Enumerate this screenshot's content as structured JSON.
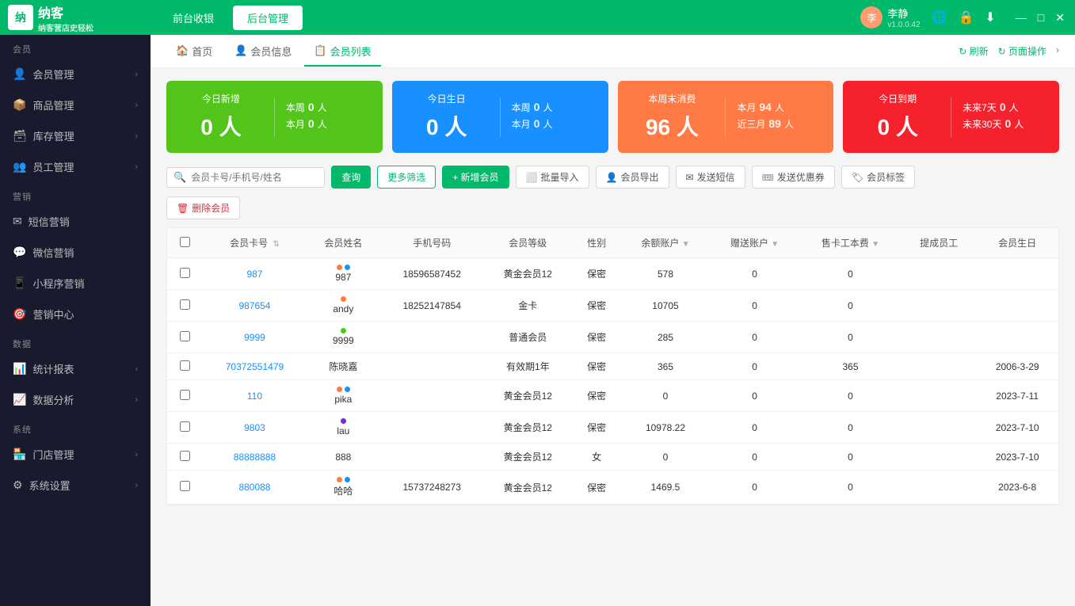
{
  "app": {
    "logo_text": "纳客",
    "logo_sub": "纳客营店史轻松",
    "tab_front": "前台收银",
    "tab_back": "后台管理",
    "version": "v1.0.0.42"
  },
  "user": {
    "name": "李静",
    "avatar_initial": "李"
  },
  "window_controls": {
    "minimize": "—",
    "maximize": "□",
    "close": "✕"
  },
  "sidebar": {
    "sections": [
      {
        "label": "会员",
        "items": [
          {
            "id": "member-mgmt",
            "icon": "👤",
            "label": "会员管理",
            "has_arrow": true
          },
          {
            "id": "product-mgmt",
            "icon": "📦",
            "label": "商品管理",
            "has_arrow": true
          },
          {
            "id": "inventory-mgmt",
            "icon": "🗃",
            "label": "库存管理",
            "has_arrow": true
          },
          {
            "id": "staff-mgmt",
            "icon": "👥",
            "label": "员工管理",
            "has_arrow": true
          }
        ]
      },
      {
        "label": "营销",
        "items": [
          {
            "id": "sms-marketing",
            "icon": "✉",
            "label": "短信营销",
            "has_arrow": false
          },
          {
            "id": "wechat-marketing",
            "icon": "💬",
            "label": "微信营销",
            "has_arrow": false
          },
          {
            "id": "mini-marketing",
            "icon": "📱",
            "label": "小程序营销",
            "has_arrow": false
          },
          {
            "id": "marketing-center",
            "icon": "🎯",
            "label": "营销中心",
            "has_arrow": false
          }
        ]
      },
      {
        "label": "数据",
        "items": [
          {
            "id": "stats-report",
            "icon": "📊",
            "label": "统计报表",
            "has_arrow": true
          },
          {
            "id": "data-analysis",
            "icon": "📈",
            "label": "数据分析",
            "has_arrow": true
          }
        ]
      },
      {
        "label": "系统",
        "items": [
          {
            "id": "store-mgmt",
            "icon": "🏪",
            "label": "门店管理",
            "has_arrow": true
          },
          {
            "id": "system-settings",
            "icon": "⚙",
            "label": "系统设置",
            "has_arrow": true
          }
        ]
      }
    ]
  },
  "nav": {
    "items": [
      {
        "id": "home",
        "icon": "🏠",
        "label": "首页",
        "active": false
      },
      {
        "id": "member-info",
        "icon": "👤",
        "label": "会员信息",
        "active": false
      },
      {
        "id": "member-list",
        "icon": "📋",
        "label": "会员列表",
        "active": true
      }
    ],
    "refresh": "刷新",
    "page_ops": "页面操作"
  },
  "stats": [
    {
      "id": "new-today",
      "color": "green",
      "title": "今日新增",
      "main_num": "0 人",
      "right": [
        {
          "label": "本周",
          "val": "0",
          "unit": "人"
        },
        {
          "label": "本月",
          "val": "0",
          "unit": "人"
        }
      ]
    },
    {
      "id": "birthday-today",
      "color": "blue",
      "title": "今日生日",
      "main_num": "0 人",
      "right": [
        {
          "label": "本周",
          "val": "0",
          "unit": "人"
        },
        {
          "label": "本月",
          "val": "0",
          "unit": "人"
        }
      ]
    },
    {
      "id": "no-consume",
      "color": "orange",
      "title": "本周末消费",
      "main_num": "96 人",
      "right": [
        {
          "label": "本月",
          "val": "94",
          "unit": "人"
        },
        {
          "label": "近三月",
          "val": "89",
          "unit": "人"
        }
      ]
    },
    {
      "id": "expiring",
      "color": "red",
      "title": "今日到期",
      "main_num": "0 人",
      "right": [
        {
          "label": "未来7天",
          "val": "0",
          "unit": "人"
        },
        {
          "label": "未来30天",
          "val": "0",
          "unit": "人"
        }
      ]
    }
  ],
  "toolbar": {
    "search_placeholder": "会员卡号/手机号/姓名",
    "search_btn": "查询",
    "filter_btn": "更多筛选",
    "add_btn": "+ 新增会员",
    "batch_import": "批量导入",
    "export": "会员导出",
    "sms": "发送短信",
    "coupon": "发送优惠券",
    "tag": "会员标签",
    "delete": "删除会员"
  },
  "table": {
    "columns": [
      {
        "id": "checkbox",
        "label": ""
      },
      {
        "id": "card_no",
        "label": "会员卡号",
        "sortable": true
      },
      {
        "id": "name",
        "label": "会员姓名"
      },
      {
        "id": "phone",
        "label": "手机号码"
      },
      {
        "id": "level",
        "label": "会员等级"
      },
      {
        "id": "gender",
        "label": "性别"
      },
      {
        "id": "balance",
        "label": "余额账户",
        "filterable": true
      },
      {
        "id": "gift",
        "label": "赠送账户",
        "filterable": true
      },
      {
        "id": "card_cost",
        "label": "售卡工本费",
        "filterable": true
      },
      {
        "id": "referrer",
        "label": "提成员工"
      },
      {
        "id": "birthday",
        "label": "会员生日"
      }
    ],
    "rows": [
      {
        "card_no": "987",
        "name": "987",
        "name_dots": [
          {
            "color": "orange"
          },
          {
            "color": "blue"
          }
        ],
        "phone": "18596587452",
        "level": "黄金会员12",
        "gender": "保密",
        "balance": "578",
        "gift": "0",
        "card_cost": "0",
        "referrer": "",
        "birthday": ""
      },
      {
        "card_no": "987654",
        "name": "andy",
        "name_dots": [
          {
            "color": "orange"
          }
        ],
        "phone": "18252147854",
        "level": "金卡",
        "gender": "保密",
        "balance": "10705",
        "gift": "0",
        "card_cost": "0",
        "referrer": "",
        "birthday": ""
      },
      {
        "card_no": "9999",
        "name": "9999",
        "name_dots": [
          {
            "color": "green"
          }
        ],
        "phone": "",
        "level": "普通会员",
        "gender": "保密",
        "balance": "285",
        "gift": "0",
        "card_cost": "0",
        "referrer": "",
        "birthday": ""
      },
      {
        "card_no": "70372551479",
        "name": "陈晓嘉",
        "name_dots": [],
        "phone": "",
        "level": "有效期1年",
        "gender": "保密",
        "balance": "365",
        "gift": "0",
        "card_cost": "365",
        "referrer": "",
        "birthday": "2006-3-29"
      },
      {
        "card_no": "110",
        "name": "pika",
        "name_dots": [
          {
            "color": "orange"
          },
          {
            "color": "blue"
          }
        ],
        "phone": "",
        "level": "黄金会员12",
        "gender": "保密",
        "balance": "0",
        "gift": "0",
        "card_cost": "0",
        "referrer": "",
        "birthday": "2023-7-11"
      },
      {
        "card_no": "9803",
        "name": "lau",
        "name_dots": [
          {
            "color": "purple"
          }
        ],
        "phone": "",
        "level": "黄金会员12",
        "gender": "保密",
        "balance": "10978.22",
        "gift": "0",
        "card_cost": "0",
        "referrer": "",
        "birthday": "2023-7-10"
      },
      {
        "card_no": "88888888",
        "name": "888",
        "name_dots": [],
        "phone": "",
        "level": "黄金会员12",
        "gender": "女",
        "balance": "0",
        "gift": "0",
        "card_cost": "0",
        "referrer": "",
        "birthday": "2023-7-10"
      },
      {
        "card_no": "880088",
        "name": "哈哈",
        "name_dots": [
          {
            "color": "orange"
          },
          {
            "color": "blue"
          }
        ],
        "phone": "15737248273",
        "level": "黄金会员12",
        "gender": "保密",
        "balance": "1469.5",
        "gift": "0",
        "card_cost": "0",
        "referrer": "",
        "birthday": "2023-6-8"
      }
    ]
  }
}
